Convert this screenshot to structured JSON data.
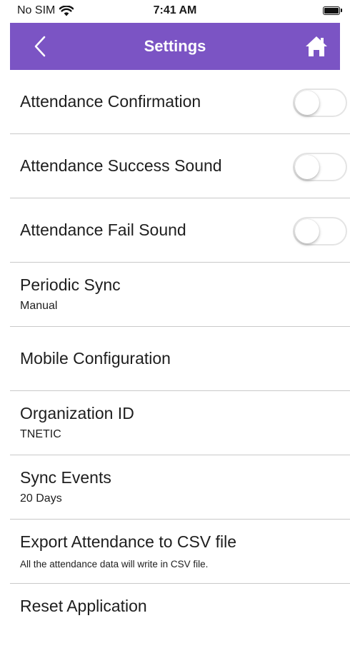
{
  "status_bar": {
    "carrier": "No SIM",
    "time": "7:41 AM",
    "wifi_icon": "wifi-icon",
    "battery_level": 1.0
  },
  "navbar": {
    "title": "Settings",
    "back_icon": "chevron-left-icon",
    "home_icon": "home-icon",
    "color": "#7b54c4"
  },
  "settings": {
    "attendance_confirmation": {
      "title": "Attendance Confirmation",
      "enabled": false
    },
    "attendance_success_sound": {
      "title": "Attendance Success Sound",
      "enabled": false
    },
    "attendance_fail_sound": {
      "title": "Attendance Fail Sound",
      "enabled": false
    },
    "periodic_sync": {
      "title": "Periodic Sync",
      "value": "Manual"
    },
    "mobile_configuration": {
      "title": "Mobile Configuration"
    },
    "organization_id": {
      "title": "Organization ID",
      "value": "TNETIC"
    },
    "sync_events": {
      "title": "Sync Events",
      "value": "20 Days"
    },
    "export_csv": {
      "title": "Export Attendance to CSV file",
      "description": "All the attendance data will write in CSV file."
    },
    "reset_application": {
      "title": "Reset Application"
    }
  }
}
